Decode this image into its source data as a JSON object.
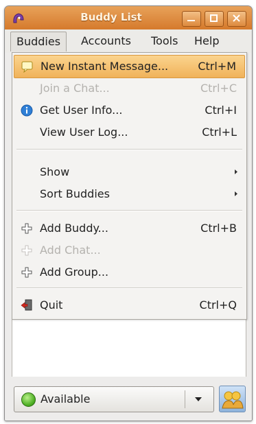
{
  "window": {
    "title": "Buddy List"
  },
  "menubar": {
    "items": [
      {
        "label": "Buddies",
        "mnemonic": "B"
      },
      {
        "label": "Accounts",
        "mnemonic": "A"
      },
      {
        "label": "Tools",
        "mnemonic": "T"
      },
      {
        "label": "Help",
        "mnemonic": "H"
      }
    ]
  },
  "dropdown": {
    "items": [
      {
        "label": "New Instant Message...",
        "shortcut": "Ctrl+M",
        "icon": "new-message-icon",
        "state": "highlighted"
      },
      {
        "label": "Join a Chat...",
        "shortcut": "Ctrl+C",
        "state": "disabled"
      },
      {
        "label": "Get User Info...",
        "shortcut": "Ctrl+I",
        "icon": "info-icon"
      },
      {
        "label": "View User Log...",
        "shortcut": "Ctrl+L"
      },
      {
        "label": "Show",
        "submenu": true
      },
      {
        "label": "Sort Buddies",
        "submenu": true
      },
      {
        "label": "Add Buddy...",
        "shortcut": "Ctrl+B",
        "icon": "add-icon"
      },
      {
        "label": "Add Chat...",
        "icon": "add-icon",
        "state": "disabled"
      },
      {
        "label": "Add Group...",
        "icon": "add-icon"
      },
      {
        "label": "Quit",
        "shortcut": "Ctrl+Q",
        "icon": "quit-icon"
      }
    ]
  },
  "status": {
    "selected": "Available",
    "icon": "available-dot-icon"
  },
  "colors": {
    "titlebar": "#d98a3c",
    "highlight": "#f5c26f",
    "available": "#4cae22",
    "info": "#2f7fd6"
  }
}
